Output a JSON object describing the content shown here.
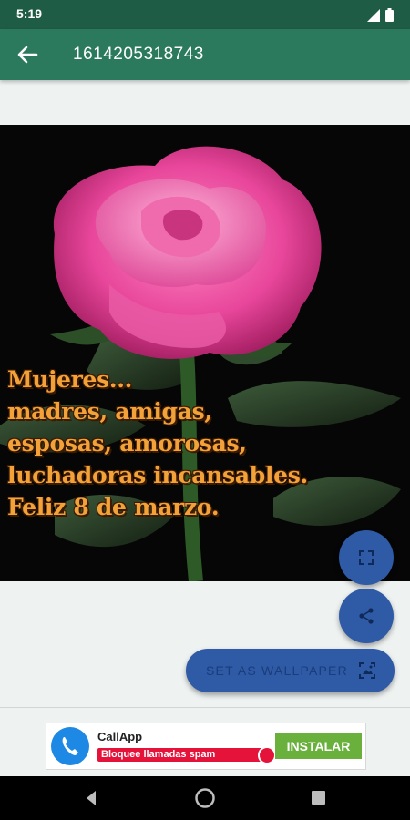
{
  "status_bar": {
    "time": "5:19"
  },
  "app_bar": {
    "title": "1614205318743",
    "back_icon": "arrow-back-icon"
  },
  "image": {
    "lines": [
      "Mujeres...",
      "madres, amigas,",
      "esposas, amorosas,",
      "luchadoras incansables.",
      "Feliz 8 de marzo."
    ]
  },
  "actions": {
    "fullscreen_icon": "fullscreen-icon",
    "share_icon": "share-icon",
    "set_wallpaper_label": "SET AS WALLPAPER",
    "wallpaper_icon": "wallpaper-icon"
  },
  "ad": {
    "app_name": "CallApp",
    "tagline": "Bloquee llamadas spam",
    "install_label": "INSTALAR"
  },
  "colors": {
    "status_bar": "#1f5c45",
    "app_bar": "#2b7a5d",
    "fab": "#2e5aa6",
    "text_orange": "#f3a23a",
    "install_green": "#69b03d",
    "ad_red": "#e5133a"
  }
}
